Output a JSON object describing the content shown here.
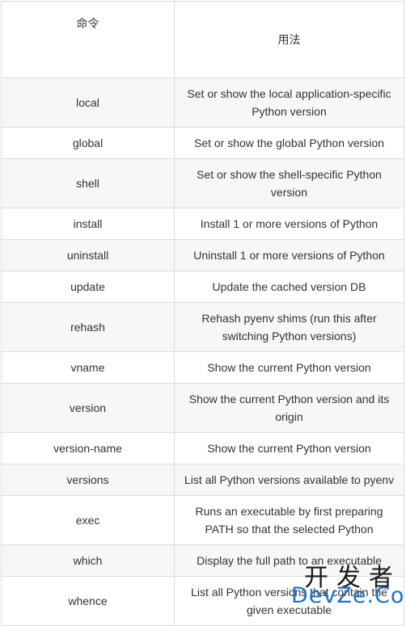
{
  "table": {
    "headers": [
      "命令",
      "用法"
    ],
    "rows": [
      {
        "command": "local",
        "usage": "Set or show the local application-specific Python version"
      },
      {
        "command": "global",
        "usage": "Set or show the global Python version"
      },
      {
        "command": "shell",
        "usage": "Set or show the shell-specific Python version"
      },
      {
        "command": "install",
        "usage": "Install 1 or more versions of Python"
      },
      {
        "command": "uninstall",
        "usage": "Uninstall 1 or more versions of Python"
      },
      {
        "command": "update",
        "usage": "Update the cached version DB"
      },
      {
        "command": "rehash",
        "usage": "Rehash pyenv shims (run this after switching Python versions)"
      },
      {
        "command": "vname",
        "usage": "Show the current Python version"
      },
      {
        "command": "version",
        "usage": "Show the current Python version and its origin"
      },
      {
        "command": "version-name",
        "usage": "Show the current Python version"
      },
      {
        "command": "versions",
        "usage": "List all Python versions available to pyenv"
      },
      {
        "command": "exec",
        "usage": "Runs an executable by first preparing PATH so that the selected Python"
      },
      {
        "command": "which",
        "usage": "Display the full path to an executable"
      },
      {
        "command": "whence",
        "usage": "List all Python versions that contain the given executable"
      }
    ]
  },
  "watermark": {
    "cn": "开发者",
    "en": "DevZe.CoM"
  }
}
